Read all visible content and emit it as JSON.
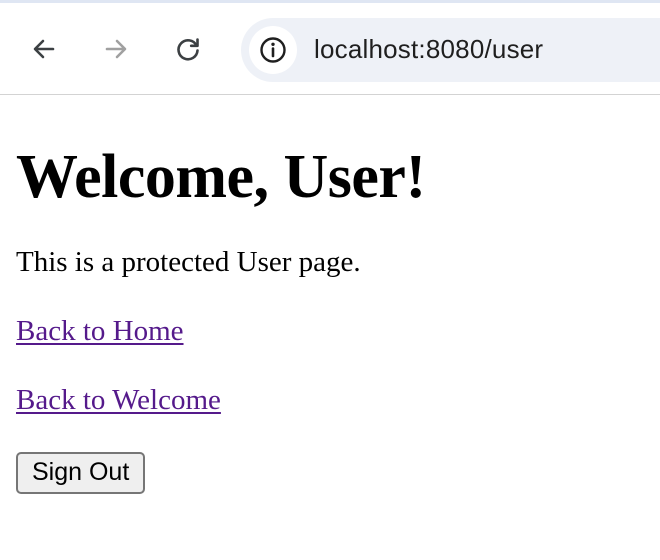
{
  "browser": {
    "url": "localhost:8080/user",
    "icons": {
      "back": "arrow-left-icon",
      "forward": "arrow-right-icon",
      "reload": "reload-icon",
      "info": "info-icon"
    },
    "colors": {
      "toolbar_bg": "#ffffff",
      "address_bg": "#eef1f7",
      "icon_active": "#3c4043",
      "icon_disabled": "#a0a0a0"
    }
  },
  "page": {
    "title": "Welcome, User!",
    "description": "This is a protected User page.",
    "links": {
      "home": "Back to Home",
      "welcome": "Back to Welcome"
    },
    "sign_out_label": "Sign Out",
    "colors": {
      "visited_link": "#551a8b",
      "text": "#000000"
    }
  }
}
